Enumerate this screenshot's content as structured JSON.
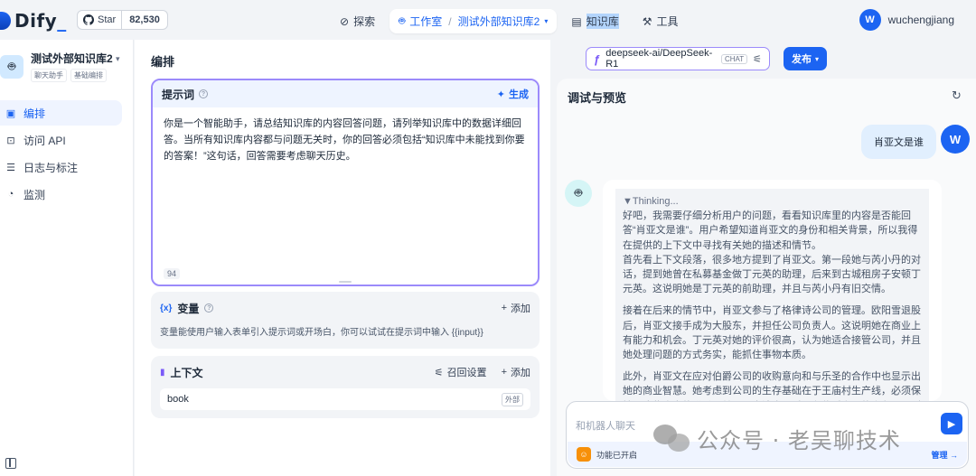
{
  "logo": {
    "text": "Dify",
    "suffix": "_"
  },
  "github": {
    "label": "Star",
    "count": "82,530"
  },
  "nav": {
    "explore": "探索",
    "studio": "工作室",
    "crumb_sep": "/",
    "app_crumb": "测试外部知识库2",
    "knowledge": "知识库",
    "tools": "工具"
  },
  "user": {
    "initial": "W",
    "name": "wuchengjiang"
  },
  "sidebar": {
    "app_name": "测试外部知识库2",
    "tags": [
      "聊天助手",
      "基础编排"
    ],
    "items": [
      {
        "label": "编排",
        "icon": "orchestrate-icon"
      },
      {
        "label": "访问 API",
        "icon": "terminal-icon"
      },
      {
        "label": "日志与标注",
        "icon": "log-icon"
      },
      {
        "label": "监测",
        "icon": "monitor-icon"
      }
    ]
  },
  "middle": {
    "title": "编排",
    "prompt": {
      "title": "提示词",
      "generate": "生成",
      "text": "你是一个智能助手，请总结知识库的内容回答问题，请列举知识库中的数据详细回答。当所有知识库内容都与问题无关时，你的回答必须包括“知识库中未能找到你要的答案！”这句话，回答需要考虑聊天历史。",
      "char_count": "94"
    },
    "variables": {
      "title": "变量",
      "add": "添加",
      "desc": "变量能使用户输入表单引入提示词或开场白，你可以试试在提示词中输入 {{input}}"
    },
    "context": {
      "title": "上下文",
      "recall": "召回设置",
      "add": "添加",
      "item": "book",
      "item_tag": "外部"
    }
  },
  "model": {
    "name": "deepseek-ai/DeepSeek-R1",
    "tag": "CHAT"
  },
  "publish": {
    "label": "发布"
  },
  "debug": {
    "title": "调试与预览",
    "question": "肖亚文是谁",
    "user_initial": "W",
    "thinking_label": "▼Thinking...",
    "paragraphs": [
      "好吧，我需要仔细分析用户的问题，看看知识库里的内容是否能回答“肖亚文是谁”。用户希望知道肖亚文的身份和相关背景，所以我得在提供的上下文中寻找有关她的描述和情节。",
      "首先看上下文段落，很多地方提到了肖亚文。第一段她与芮小丹的对话，提到她曾在私募基金做丁元英的助理，后来到古城租房子安顿丁元英。这说明她是丁元英的前助理，并且与芮小丹有旧交情。",
      "接着在后来的情节中，肖亚文参与了格律诗公司的管理。欧阳雪退股后，肖亚文接手成为大股东，并担任公司负责人。这说明她在商业上有能力和机会。丁元英对她的评价很高，认为她适合接管公司，并且她处理问题的方式务实，能抓住事物本质。",
      "此外，肖亚文在应对伯爵公司的收购意向和与乐圣的合作中也显示出她的商业智慧。她考虑到公司的生存基础在于王庙村生产线，必须保持与这些农户的联系，并且不应该卷入乐圣和伯爵之间的竞争，否则公司可能会被拖垮"
    ],
    "input_placeholder": "和机器人聊天",
    "feature_label": "功能已开启",
    "manage": "管理"
  },
  "watermark": {
    "text": "公众号 · 老吴聊技术"
  }
}
